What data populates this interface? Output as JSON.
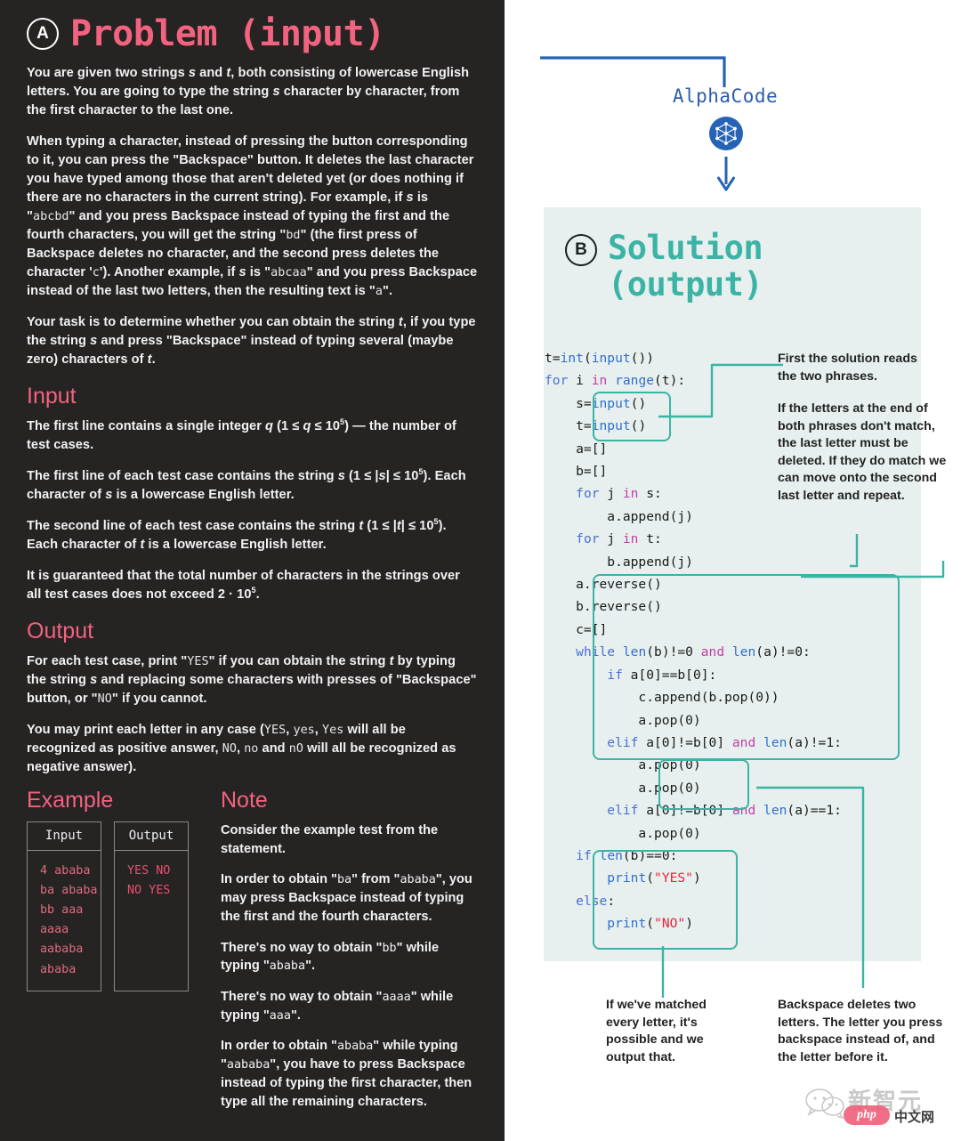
{
  "left": {
    "badge": "A",
    "title": "Problem (input)",
    "paragraphs": [
      "You are given two strings s and t, both consisting of lowercase English letters. You are going to type the string s character by character, from the first character to the last one.",
      "When typing a character, instead of pressing the button corresponding to it, you can press the \"Backspace\" button. It deletes the last character you have typed among those that aren't deleted yet (or does nothing if there are no characters in the current string). For example, if s is \"abcbd\" and you press Backspace instead of typing the first and the fourth characters, you will get the string \"bd\" (the first press of Backspace deletes no character, and the second press deletes the character 'c'). Another example, if s is \"abcaa\" and you press Backspace instead of the last two letters, then the resulting text is \"a\".",
      "Your task is to determine whether you can obtain the string t, if you type the string s and press \"Backspace\" instead of typing several (maybe zero) characters of t."
    ],
    "input_heading": "Input",
    "input_paragraphs": [
      "The first line contains a single integer q (1 ≤ q ≤ 10⁵) — the number of test cases.",
      "The first line of each test case contains the string s (1 ≤ |s| ≤ 10⁵). Each character of s is a lowercase English letter.",
      "The second line of each test case contains the string t (1 ≤ |t| ≤ 10⁵). Each character of t is a lowercase English letter.",
      "It is guaranteed that the total number of characters in the strings over all test cases does not exceed 2 · 10⁵."
    ],
    "output_heading": "Output",
    "output_paragraphs": [
      "For each test case, print \"YES\" if you can obtain the string t by typing the string s and replacing some characters with presses of \"Backspace\" button, or \"NO\" if you cannot.",
      "You may print each letter in any case (YES, yes, Yes will all be recognized as positive answer, NO, no and nO will all be recognized as negative answer)."
    ],
    "example_heading": "Example",
    "note_heading": "Note",
    "example": {
      "input_header": "Input",
      "output_header": "Output",
      "input_lines": [
        "4",
        "ababa",
        "ba",
        "ababa",
        "bb",
        "aaa",
        "aaaa",
        "aababa",
        "ababa"
      ],
      "output_lines": [
        "YES",
        "NO",
        "NO",
        "YES"
      ]
    },
    "notes": [
      "Consider the example test from the statement.",
      "In order to obtain \"ba\" from \"ababa\", you may press Backspace instead of typing the first and the fourth characters.",
      "There's no way to obtain \"bb\" while typing \"ababa\".",
      "There's no way to obtain \"aaaa\" while typing \"aaa\".",
      "In order to obtain \"ababa\" while typing \"aababa\", you have to press Backspace instead of typing the first character, then type all the remaining characters."
    ]
  },
  "right": {
    "alphacode_label": "AlphaCode",
    "logo_name": "alphacode-logo",
    "badge": "B",
    "solution_title_line1": "Solution",
    "solution_title_line2": "(output)",
    "code_lines": [
      "t=int(input())",
      "for i in range(t):",
      "    s=input()",
      "    t=input()",
      "    a=[]",
      "    b=[]",
      "    for j in s:",
      "        a.append(j)",
      "    for j in t:",
      "        b.append(j)",
      "    a.reverse()",
      "    b.reverse()",
      "    c=[]",
      "    while len(b)!=0 and len(a)!=0:",
      "        if a[0]==b[0]:",
      "            c.append(b.pop(0))",
      "            a.pop(0)",
      "        elif a[0]!=b[0] and len(a)!=1:",
      "            a.pop(0)",
      "            a.pop(0)",
      "        elif a[0]!=b[0] and len(a)==1:",
      "            a.pop(0)",
      "    if len(b)==0:",
      "        print(\"YES\")",
      "    else:",
      "        print(\"NO\")"
    ],
    "annotations": [
      "First the solution reads the two phrases.",
      "If the letters at the end of both phrases don't match, the last letter must be deleted. If they do match we can move onto the second last letter and repeat.",
      "If we've matched every letter, it's possible and we output that.",
      "Backspace deletes two letters. The letter you press backspace instead of, and the letter before it."
    ]
  },
  "watermark": {
    "brand": "新智元",
    "php": "php",
    "cn": "中文网"
  },
  "colors": {
    "panel_dark": "#262323",
    "pink": "#f2637f",
    "teal": "#3bb4a5",
    "card": "#e7f0ee",
    "blue": "#2763b5"
  }
}
